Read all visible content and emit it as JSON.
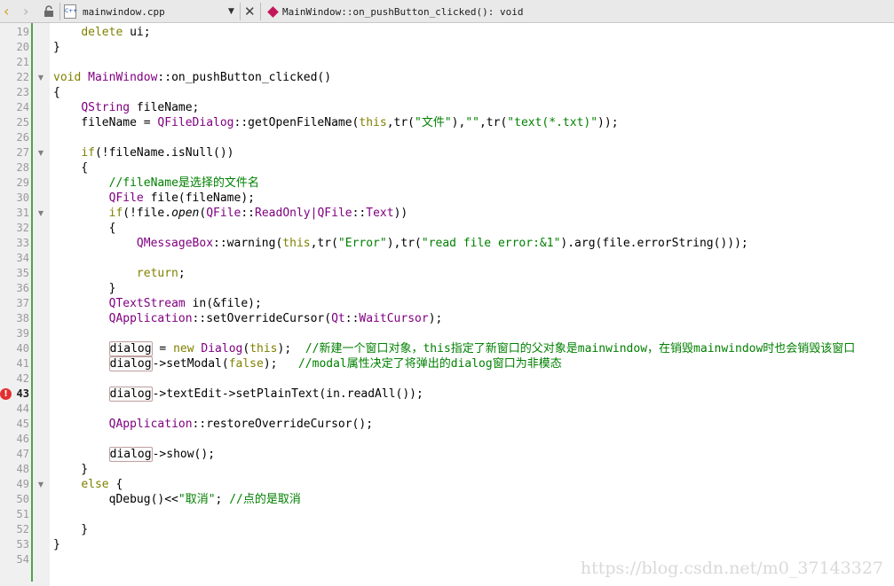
{
  "toolbar": {
    "file_name": "mainwindow.cpp",
    "file_icon_label": "C++",
    "symbol": "MainWindow::on_pushButton_clicked(): void",
    "back_icon": "chevron-left-icon",
    "forward_icon": "chevron-right-icon",
    "lock_icon": "lock-icon",
    "dropdown_icon": "caret-down-icon",
    "close_icon": "close-icon"
  },
  "colors": {
    "keyword": "#808000",
    "type": "#800080",
    "string": "#008000",
    "comment": "#008000",
    "error": "#e2302f",
    "margin": "#4fa34f"
  },
  "lines": [
    {
      "n": "19",
      "text": "    delete ui;"
    },
    {
      "n": "20",
      "text": "}"
    },
    {
      "n": "21",
      "text": ""
    },
    {
      "n": "22",
      "text": "void MainWindow::on_pushButton_clicked()"
    },
    {
      "n": "23",
      "text": "{"
    },
    {
      "n": "24",
      "text": "    QString fileName;"
    },
    {
      "n": "25",
      "text": "    fileName = QFileDialog::getOpenFileName(this,tr(\"文件\"),\"\",tr(\"text(*.txt)\"));"
    },
    {
      "n": "26",
      "text": ""
    },
    {
      "n": "27",
      "text": "    if(!fileName.isNull())"
    },
    {
      "n": "28",
      "text": "    {"
    },
    {
      "n": "29",
      "text": "        //fileName是选择的文件名"
    },
    {
      "n": "30",
      "text": "        QFile file(fileName);"
    },
    {
      "n": "31",
      "text": "        if(!file.open(QFile::ReadOnly|QFile::Text))"
    },
    {
      "n": "32",
      "text": "        {"
    },
    {
      "n": "33",
      "text": "            QMessageBox::warning(this,tr(\"Error\"),tr(\"read file error:&1\").arg(file.errorString()));"
    },
    {
      "n": "34",
      "text": ""
    },
    {
      "n": "35",
      "text": "            return;"
    },
    {
      "n": "36",
      "text": "        }"
    },
    {
      "n": "37",
      "text": "        QTextStream in(&file);"
    },
    {
      "n": "38",
      "text": "        QApplication::setOverrideCursor(Qt::WaitCursor);"
    },
    {
      "n": "39",
      "text": ""
    },
    {
      "n": "40",
      "text": "        dialog = new Dialog(this);  //新建一个窗口对象，this指定了新窗口的父对象是mainwindow，在销毁mainwindow时也会销毁该窗口"
    },
    {
      "n": "41",
      "text": "        dialog->setModal(false);   //modal属性决定了将弹出的dialog窗口为非模态"
    },
    {
      "n": "42",
      "text": ""
    },
    {
      "n": "43",
      "text": "        dialog->textEdit->setPlainText(in.readAll());"
    },
    {
      "n": "44",
      "text": ""
    },
    {
      "n": "45",
      "text": "        QApplication::restoreOverrideCursor();"
    },
    {
      "n": "46",
      "text": ""
    },
    {
      "n": "47",
      "text": "        dialog->show();"
    },
    {
      "n": "48",
      "text": "    }"
    },
    {
      "n": "49",
      "text": "    else {"
    },
    {
      "n": "50",
      "text": "        qDebug()<<\"取消\"; //点的是取消"
    },
    {
      "n": "51",
      "text": ""
    },
    {
      "n": "52",
      "text": "    }"
    },
    {
      "n": "53",
      "text": "}"
    },
    {
      "n": "54",
      "text": ""
    }
  ],
  "current_line": "43",
  "error_line": "43",
  "watermark": "https://blog.csdn.net/m0_37143327"
}
